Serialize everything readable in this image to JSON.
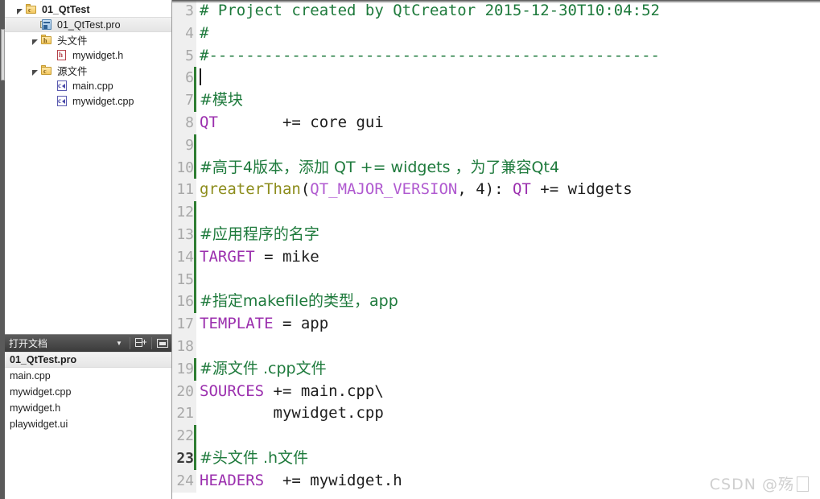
{
  "sidebar": {
    "project_tree": {
      "name": "project-tree",
      "items": [
        {
          "label": "01_QtTest",
          "icon": "folder-project-icon",
          "depth": 0,
          "expander": "expanded",
          "selected": false,
          "bold": true,
          "icon_kind": "folder"
        },
        {
          "label": "01_QtTest.pro",
          "icon": "pro-file-icon",
          "depth": 1,
          "expander": "none",
          "selected": true,
          "bold": false,
          "icon_kind": "pro"
        },
        {
          "label": "头文件",
          "icon": "folder-headers-icon",
          "depth": 1,
          "expander": "expanded",
          "selected": false,
          "bold": false,
          "icon_kind": "folder-h"
        },
        {
          "label": "mywidget.h",
          "icon": "h-file-icon",
          "depth": 2,
          "expander": "none",
          "selected": false,
          "bold": false,
          "icon_kind": "h"
        },
        {
          "label": "源文件",
          "icon": "folder-sources-icon",
          "depth": 1,
          "expander": "expanded",
          "selected": false,
          "bold": false,
          "icon_kind": "folder-c"
        },
        {
          "label": "main.cpp",
          "icon": "cpp-file-icon",
          "depth": 2,
          "expander": "none",
          "selected": false,
          "bold": false,
          "icon_kind": "cpp"
        },
        {
          "label": "mywidget.cpp",
          "icon": "cpp-file-icon",
          "depth": 2,
          "expander": "none",
          "selected": false,
          "bold": false,
          "icon_kind": "cpp"
        }
      ]
    },
    "open_documents": {
      "title": "打开文档",
      "caret_icon": "chevron-down-icon",
      "split_icon": "split-editor-icon",
      "close_icon": "close-panel-icon",
      "items": [
        {
          "label": "01_QtTest.pro",
          "selected": true
        },
        {
          "label": "main.cpp",
          "selected": false
        },
        {
          "label": "mywidget.cpp",
          "selected": false
        },
        {
          "label": "mywidget.h",
          "selected": false
        },
        {
          "label": "playwidget.ui",
          "selected": false
        }
      ]
    }
  },
  "editor": {
    "name": "code-editor",
    "language": "qmake",
    "colors": {
      "comment": "#1e7a3c",
      "variable": "#9b2fae",
      "function": "#8d8d1d",
      "constant": "#b05ad0",
      "plain": "#1d1d1d",
      "gutter_bg": "#efefef",
      "change_marker": "#2e7d32"
    },
    "lines": [
      {
        "num": "3",
        "current": false,
        "changed": false,
        "caret": false,
        "tokens": [
          {
            "t": "# Project created by QtCreator 2015-12-30T10:04:52",
            "c": "cm"
          }
        ]
      },
      {
        "num": "4",
        "current": false,
        "changed": false,
        "caret": false,
        "tokens": [
          {
            "t": "#",
            "c": "cm"
          }
        ]
      },
      {
        "num": "5",
        "current": false,
        "changed": false,
        "caret": false,
        "tokens": [
          {
            "t": "#-------------------------------------------------",
            "c": "cm"
          }
        ]
      },
      {
        "num": "6",
        "current": false,
        "changed": true,
        "caret": true,
        "tokens": []
      },
      {
        "num": "7",
        "current": false,
        "changed": true,
        "caret": false,
        "tokens": [
          {
            "t": "#模块",
            "c": "cm cjk"
          }
        ]
      },
      {
        "num": "8",
        "current": false,
        "changed": false,
        "caret": false,
        "tokens": [
          {
            "t": "QT",
            "c": "kw"
          },
          {
            "t": "       += core gui",
            "c": "pl"
          }
        ]
      },
      {
        "num": "9",
        "current": false,
        "changed": true,
        "caret": false,
        "tokens": []
      },
      {
        "num": "10",
        "current": false,
        "changed": true,
        "caret": false,
        "tokens": [
          {
            "t": "#高于4版本，添加 QT += widgets ，为了兼容Qt4",
            "c": "cm cjk"
          }
        ]
      },
      {
        "num": "11",
        "current": false,
        "changed": false,
        "caret": false,
        "tokens": [
          {
            "t": "greaterThan",
            "c": "fn"
          },
          {
            "t": "(",
            "c": "pl"
          },
          {
            "t": "QT_MAJOR_VERSION",
            "c": "cn"
          },
          {
            "t": ", 4): ",
            "c": "pl"
          },
          {
            "t": "QT",
            "c": "kw"
          },
          {
            "t": " += widgets",
            "c": "pl"
          }
        ]
      },
      {
        "num": "12",
        "current": false,
        "changed": true,
        "caret": false,
        "tokens": []
      },
      {
        "num": "13",
        "current": false,
        "changed": true,
        "caret": false,
        "tokens": [
          {
            "t": "#应用程序的名字",
            "c": "cm cjk"
          }
        ]
      },
      {
        "num": "14",
        "current": false,
        "changed": true,
        "caret": false,
        "tokens": [
          {
            "t": "TARGET",
            "c": "kw"
          },
          {
            "t": " = mike",
            "c": "pl"
          }
        ]
      },
      {
        "num": "15",
        "current": false,
        "changed": true,
        "caret": false,
        "tokens": []
      },
      {
        "num": "16",
        "current": false,
        "changed": true,
        "caret": false,
        "tokens": [
          {
            "t": "#指定makefile的类型，app",
            "c": "cm cjk"
          }
        ]
      },
      {
        "num": "17",
        "current": false,
        "changed": false,
        "caret": false,
        "tokens": [
          {
            "t": "TEMPLATE",
            "c": "kw"
          },
          {
            "t": " = app",
            "c": "pl"
          }
        ]
      },
      {
        "num": "18",
        "current": false,
        "changed": false,
        "caret": false,
        "tokens": []
      },
      {
        "num": "19",
        "current": false,
        "changed": true,
        "caret": false,
        "tokens": [
          {
            "t": "#源文件 .cpp文件",
            "c": "cm cjk"
          }
        ]
      },
      {
        "num": "20",
        "current": false,
        "changed": false,
        "caret": false,
        "tokens": [
          {
            "t": "SOURCES",
            "c": "kw"
          },
          {
            "t": " += main.cpp\\",
            "c": "pl"
          }
        ]
      },
      {
        "num": "21",
        "current": false,
        "changed": false,
        "caret": false,
        "tokens": [
          {
            "t": "        mywidget.cpp",
            "c": "pl"
          }
        ]
      },
      {
        "num": "22",
        "current": false,
        "changed": true,
        "caret": false,
        "tokens": []
      },
      {
        "num": "23",
        "current": true,
        "changed": true,
        "caret": false,
        "tokens": [
          {
            "t": "#头文件 .h文件",
            "c": "cm cjk"
          }
        ]
      },
      {
        "num": "24",
        "current": false,
        "changed": false,
        "caret": false,
        "tokens": [
          {
            "t": "HEADERS",
            "c": "kw"
          },
          {
            "t": "  += mywidget.h",
            "c": "pl"
          }
        ]
      }
    ]
  },
  "watermark": {
    "text": "CSDN @殇"
  }
}
